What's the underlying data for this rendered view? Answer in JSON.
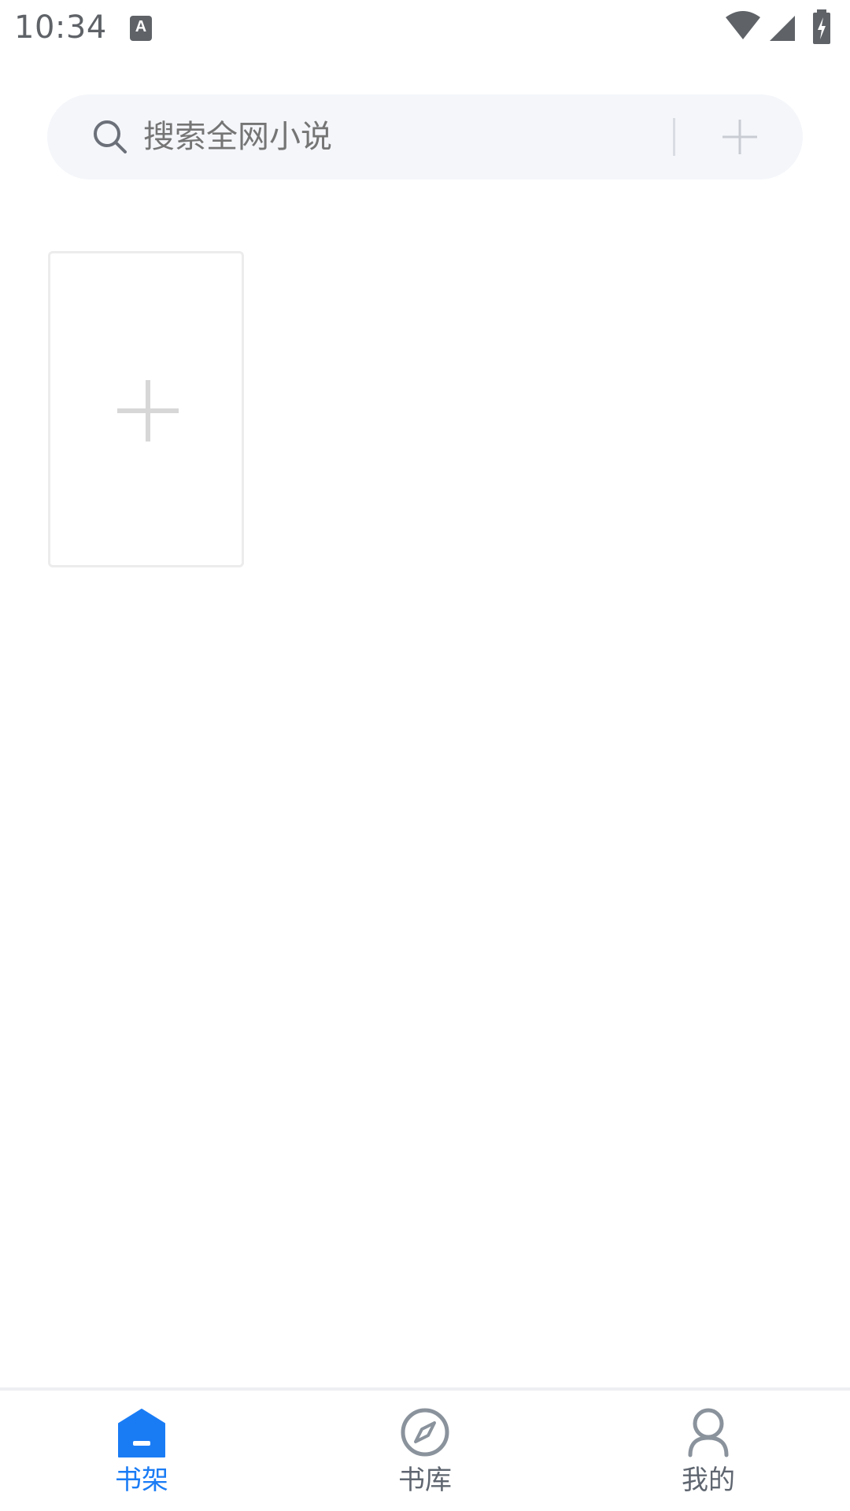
{
  "status_bar": {
    "time": "10:34",
    "app_icon_letter": "A",
    "icons": [
      "wifi-icon",
      "cellular-signal-icon",
      "battery-charging-icon"
    ]
  },
  "search": {
    "placeholder": "搜索全网小说",
    "icon": "search-icon",
    "add_icon": "plus-icon"
  },
  "bookshelf": {
    "add_card_icon": "plus-icon",
    "books": []
  },
  "bottom_nav": {
    "items": [
      {
        "label": "书架",
        "icon": "home-icon",
        "active": true
      },
      {
        "label": "书库",
        "icon": "compass-icon",
        "active": false
      },
      {
        "label": "我的",
        "icon": "person-icon",
        "active": false
      }
    ],
    "active_color": "#1a7cf5",
    "inactive_color": "#5f6670"
  }
}
